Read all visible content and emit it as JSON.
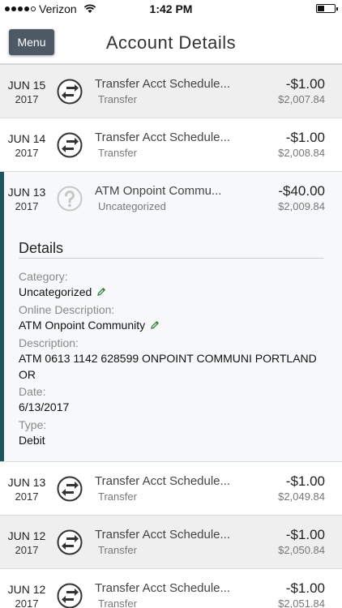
{
  "status_bar": {
    "carrier": "Verizon",
    "time": "1:42 PM"
  },
  "header": {
    "menu_label": "Menu",
    "title": "Account Details"
  },
  "transactions": [
    {
      "month_day": "JUN 15",
      "year": "2017",
      "icon": "transfer-icon",
      "description": "Transfer Acct Schedule...",
      "category": "Transfer",
      "amount": "-$1.00",
      "balance": "$2,007.84"
    },
    {
      "month_day": "JUN 14",
      "year": "2017",
      "icon": "transfer-icon",
      "description": "Transfer Acct Schedule...",
      "category": "Transfer",
      "amount": "-$1.00",
      "balance": "$2,008.84"
    },
    {
      "month_day": "JUN 13",
      "year": "2017",
      "icon": "question-icon",
      "description": "ATM Onpoint Commu...",
      "category": "Uncategorized",
      "amount": "-$40.00",
      "balance": "$2,009.84"
    },
    {
      "month_day": "JUN 13",
      "year": "2017",
      "icon": "transfer-icon",
      "description": "Transfer Acct Schedule...",
      "category": "Transfer",
      "amount": "-$1.00",
      "balance": "$2,049.84"
    },
    {
      "month_day": "JUN 12",
      "year": "2017",
      "icon": "transfer-icon",
      "description": "Transfer Acct Schedule...",
      "category": "Transfer",
      "amount": "-$1.00",
      "balance": "$2,050.84"
    },
    {
      "month_day": "JUN 12",
      "year": "2017",
      "icon": "transfer-icon",
      "description": "Transfer Acct Schedule...",
      "category": "Transfer",
      "amount": "-$1.00",
      "balance": "$2,051.84"
    }
  ],
  "details": {
    "title": "Details",
    "category_label": "Category:",
    "category_value": "Uncategorized",
    "online_description_label": "Online Description:",
    "online_description_value": "ATM Onpoint Community",
    "description_label": "Description:",
    "description_value": "ATM 0613 1142 628599 ONPOINT COMMUNI PORTLAND OR",
    "date_label": "Date:",
    "date_value": "6/13/2017",
    "type_label": "Type:",
    "type_value": "Debit"
  },
  "colors": {
    "accent": "#1f5560",
    "menu_button": "#4d5a65"
  }
}
